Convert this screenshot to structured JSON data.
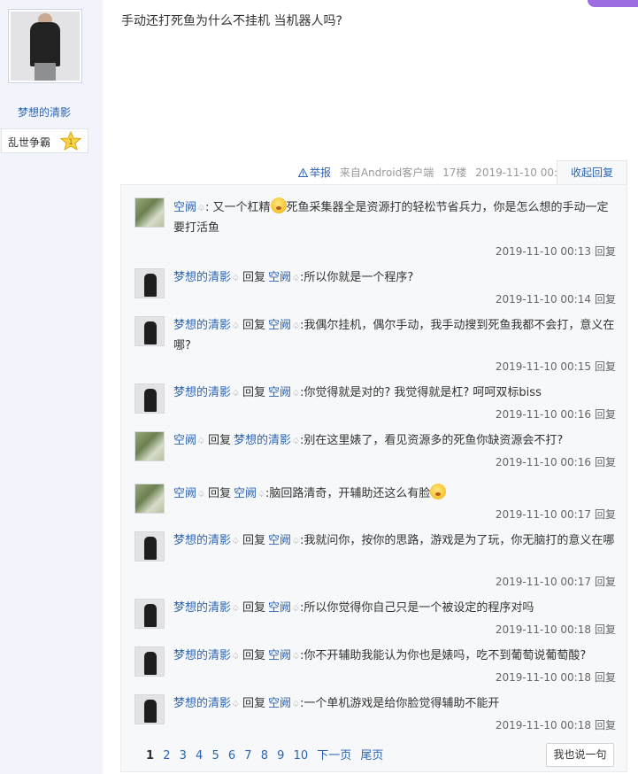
{
  "post": {
    "author": "梦想的清影",
    "level_name": "乱世争霸",
    "level_num": "1",
    "content": "手动还打死鱼为什么不挂机 当机器人吗?",
    "meta": {
      "report": "举报",
      "client": "来自Android客户端",
      "floor": "17楼",
      "time": "2019-11-10 00:02",
      "collapse": "收起回复"
    }
  },
  "replies": [
    {
      "avatar": "green",
      "user": "空阙",
      "reply_word": "",
      "target": "",
      "segments": [
        ":  又一个杠精",
        "死鱼采集器全是资源打的轻松节省兵力，你是怎么想的手动一定要打活鱼"
      ],
      "emoji": true,
      "time": "2019-11-10 00:13",
      "reply": "回复"
    },
    {
      "avatar": "dark",
      "user": "梦想的清影",
      "reply_word": "回复",
      "target": "空阙",
      "segments": [
        ":所以你就是一个程序?"
      ],
      "emoji": false,
      "time": "2019-11-10 00:14",
      "reply": "回复"
    },
    {
      "avatar": "dark",
      "user": "梦想的清影",
      "reply_word": "回复",
      "target": "空阙",
      "segments": [
        ":我偶尔挂机，偶尔手动，我手动搜到死鱼我都不会打，意义在哪?"
      ],
      "emoji": false,
      "time": "2019-11-10 00:15",
      "reply": "回复"
    },
    {
      "avatar": "dark",
      "user": "梦想的清影",
      "reply_word": "回复",
      "target": "空阙",
      "segments": [
        ":你觉得就是对的? 我觉得就是杠? 呵呵双标biss"
      ],
      "emoji": false,
      "time": "2019-11-10 00:16",
      "reply": "回复"
    },
    {
      "avatar": "green",
      "user": "空阙",
      "reply_word": "回复",
      "target": "梦想的清影",
      "segments": [
        ":别在这里婊了，看见资源多的死鱼你缺资源会不打?"
      ],
      "emoji": false,
      "time": "2019-11-10 00:16",
      "reply": "回复"
    },
    {
      "avatar": "green",
      "user": "空阙",
      "reply_word": "回复",
      "target": "空阙",
      "segments": [
        ":脑回路清奇，开辅助还这么有脸",
        ""
      ],
      "emoji": true,
      "time": "2019-11-10 00:17",
      "reply": "回复"
    },
    {
      "avatar": "dark",
      "user": "梦想的清影",
      "reply_word": "回复",
      "target": "空阙",
      "segments": [
        ":我就问你，按你的思路，游戏是为了玩，你无脑打的意义在哪"
      ],
      "emoji": false,
      "time": "2019-11-10 00:17",
      "reply": "回复"
    },
    {
      "avatar": "dark",
      "user": "梦想的清影",
      "reply_word": "回复",
      "target": "空阙",
      "segments": [
        ":所以你觉得你自己只是一个被设定的程序对吗"
      ],
      "emoji": false,
      "time": "2019-11-10 00:18",
      "reply": "回复"
    },
    {
      "avatar": "dark",
      "user": "梦想的清影",
      "reply_word": "回复",
      "target": "空阙",
      "segments": [
        ":你不开辅助我能认为你也是婊吗，吃不到葡萄说葡萄酸?"
      ],
      "emoji": false,
      "time": "2019-11-10 00:18",
      "reply": "回复"
    },
    {
      "avatar": "dark",
      "user": "梦想的清影",
      "reply_word": "回复",
      "target": "空阙",
      "segments": [
        ":一个单机游戏是给你脸觉得辅助不能开"
      ],
      "emoji": false,
      "time": "2019-11-10 00:18",
      "reply": "回复"
    }
  ],
  "pager": {
    "pages": [
      "1",
      "2",
      "3",
      "4",
      "5",
      "6",
      "7",
      "8",
      "9",
      "10"
    ],
    "next": "下一页",
    "last": "尾页"
  },
  "say_button": "我也说一句"
}
